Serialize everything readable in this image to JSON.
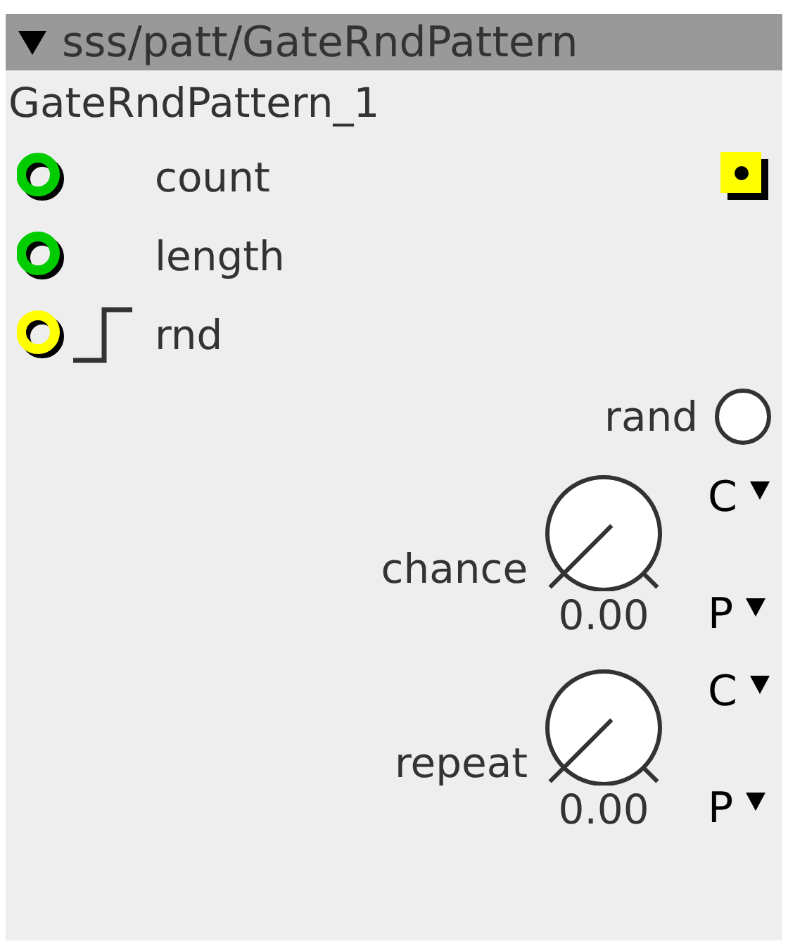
{
  "header": {
    "expanded": true,
    "title": "sss/patt/GateRndPattern"
  },
  "instance_name": "GateRndPattern_1",
  "inlets": [
    {
      "name": "count",
      "color": "#00cc00",
      "kind": "plain"
    },
    {
      "name": "length",
      "color": "#00cc00",
      "kind": "plain"
    },
    {
      "name": "rnd",
      "color": "#ffff00",
      "kind": "trigger"
    }
  ],
  "outlets": [
    {
      "color": "#ffff00"
    }
  ],
  "toggle": {
    "label": "rand",
    "on": false
  },
  "knobs": [
    {
      "label": "chance",
      "value": "0.00",
      "top_option": "C",
      "bottom_option": "P"
    },
    {
      "label": "repeat",
      "value": "0.00",
      "top_option": "C",
      "bottom_option": "P"
    }
  ]
}
